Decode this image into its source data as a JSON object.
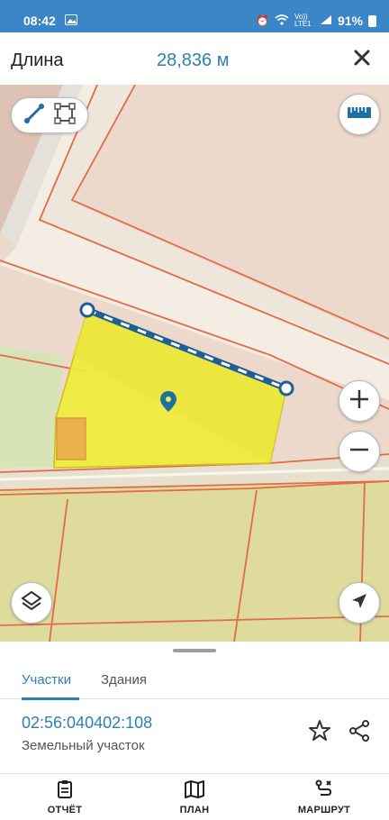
{
  "status_bar": {
    "time": "08:42",
    "battery": "91%",
    "network": "Vo)) LTE1"
  },
  "toolbar": {
    "title": "Длина",
    "measurement": "28,836 м"
  },
  "map": {
    "polygon_color": "#f0ec3a",
    "line_color": "#1f5f94"
  },
  "sheet": {
    "tabs": [
      {
        "label": "Участки"
      },
      {
        "label": "Здания"
      }
    ],
    "parcel": {
      "cadastral_number": "02:56:040402:108",
      "type": "Земельный участок"
    }
  },
  "bottom_nav": {
    "items": [
      {
        "label": "ОТЧЁТ",
        "icon": "report-icon"
      },
      {
        "label": "ПЛАН",
        "icon": "map-icon"
      },
      {
        "label": "МАРШРУТ",
        "icon": "route-icon"
      }
    ]
  }
}
